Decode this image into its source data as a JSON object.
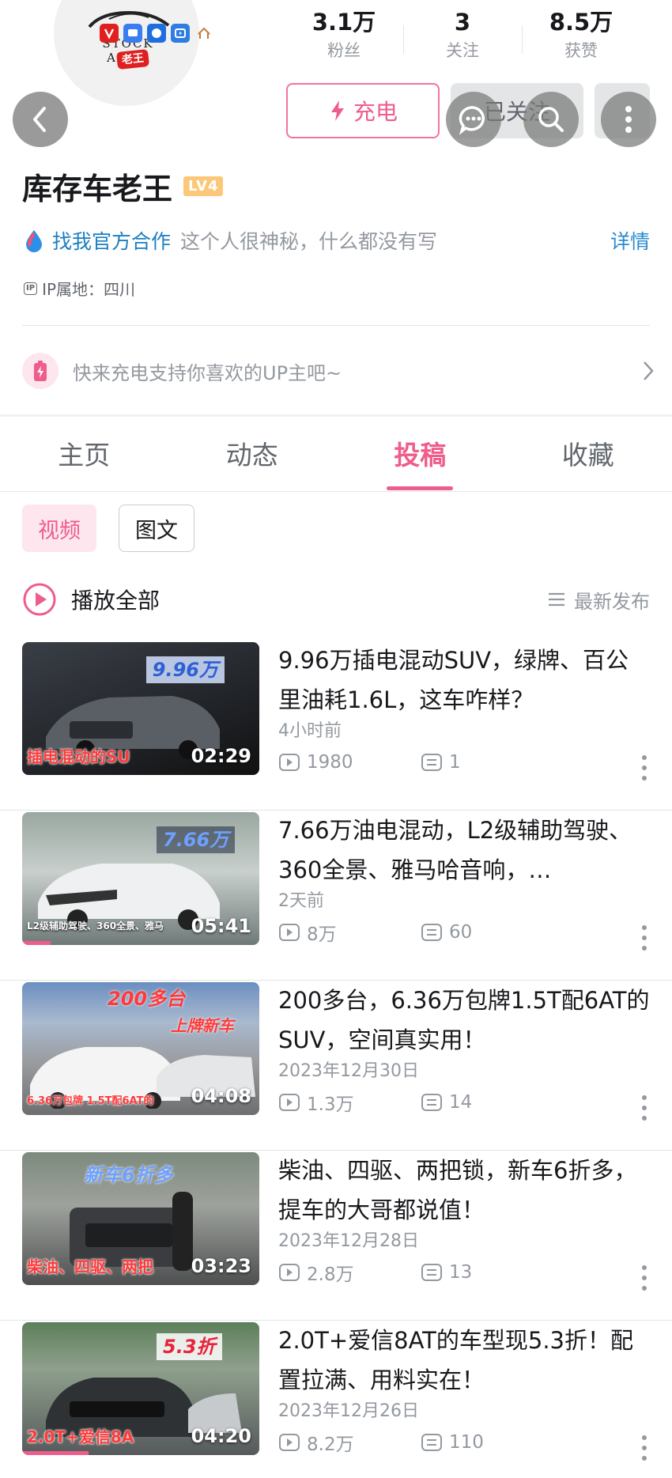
{
  "avatar": {
    "logo_text": "STOCK AUTO",
    "logo_badge": "老王"
  },
  "stats": [
    {
      "value": "3.1万",
      "label": "粉丝"
    },
    {
      "value": "3",
      "label": "关注"
    },
    {
      "value": "8.5万",
      "label": "获赞"
    }
  ],
  "actions": {
    "charge_label": "充电",
    "followed_label": "已关注"
  },
  "profile": {
    "name": "库存车老王",
    "level": "LV4",
    "cooperation": "找我官方合作",
    "bio": "这个人很神秘，什么都没有写",
    "detail_link": "详情",
    "ip_tag": "IP",
    "ip_location": "IP属地：四川"
  },
  "charge_tip": "快来充电支持你喜欢的UP主吧~",
  "tabs": [
    {
      "label": "主页",
      "active": false
    },
    {
      "label": "动态",
      "active": false
    },
    {
      "label": "投稿",
      "active": true
    },
    {
      "label": "收藏",
      "active": false
    }
  ],
  "chips": [
    {
      "label": "视频",
      "active": true
    },
    {
      "label": "图文",
      "active": false
    }
  ],
  "play_all": "播放全部",
  "sort": "最新发布",
  "videos": [
    {
      "title": "9.96万插电混动SUV，绿牌、百公里油耗1.6L，这车咋样？",
      "date": "4小时前",
      "views": "1980",
      "comments": "1",
      "duration": "02:29",
      "thumb_banner": "9.96万",
      "thumb_caption": "插电混动的SU",
      "watched_fraction": 0
    },
    {
      "title": "7.66万油电混动，L2级辅助驾驶、360全景、雅马哈音响，…",
      "date": "2天前",
      "views": "8万",
      "comments": "60",
      "duration": "05:41",
      "thumb_banner": "7.66万",
      "thumb_caption": "L2级辅助驾驶、360全景、雅马",
      "watched_fraction": 0.12
    },
    {
      "title": "200多台，6.36万包牌1.5T配6AT的SUV，空间真实用！",
      "date": "2023年12月30日",
      "views": "1.3万",
      "comments": "14",
      "duration": "04:08",
      "thumb_banner": "200多台",
      "thumb_banner2": "上牌新车",
      "thumb_caption": "6.36万包牌 1.5T配6AT的",
      "watched_fraction": 0
    },
    {
      "title": "柴油、四驱、两把锁，新车6折多，提车的大哥都说值！",
      "date": "2023年12月28日",
      "views": "2.8万",
      "comments": "13",
      "duration": "03:23",
      "thumb_banner": "新车6折多",
      "thumb_caption": "柴油、四驱、两把",
      "watched_fraction": 0
    },
    {
      "title": "2.0T+爱信8AT的车型现5.3折！配置拉满、用料实在！",
      "date": "2023年12月26日",
      "views": "8.2万",
      "comments": "110",
      "duration": "04:20",
      "thumb_banner": "5.3折",
      "thumb_caption": "2.0T+爱信8A",
      "watched_fraction": 0.28
    }
  ],
  "colors": {
    "accent": "#ee5d8b",
    "link": "#1a7fc1",
    "muted": "#9499a0",
    "level_badge": "#fbc87a"
  },
  "icons": [
    "back-arrow-icon",
    "lightning-icon",
    "chat-icon",
    "search-icon",
    "more-vertical-icon",
    "ip-tag-icon",
    "battery-charge-icon",
    "chevron-right-icon",
    "play-circle-icon",
    "sort-list-icon",
    "play-count-icon",
    "comment-count-icon"
  ]
}
